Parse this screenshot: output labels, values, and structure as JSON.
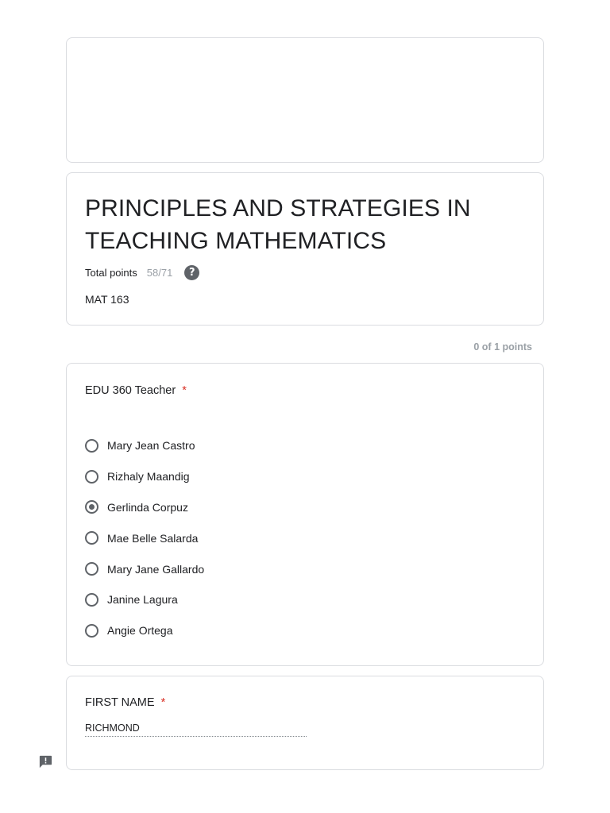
{
  "form": {
    "title": "PRINCIPLES AND STRATEGIES IN TEACHING MATHEMATICS",
    "total_points_label": "Total points",
    "total_points_value": "58/71",
    "course_code": "MAT 163"
  },
  "question_edu360": {
    "score": "0 of 1 points",
    "title": "EDU 360 Teacher",
    "required_mark": "*",
    "options": [
      {
        "label": "Mary Jean Castro",
        "selected": false
      },
      {
        "label": "Rizhaly Maandig",
        "selected": false
      },
      {
        "label": "Gerlinda Corpuz",
        "selected": true
      },
      {
        "label": "Mae Belle Salarda",
        "selected": false
      },
      {
        "label": "Mary Jane Gallardo",
        "selected": false
      },
      {
        "label": "Janine Lagura",
        "selected": false
      },
      {
        "label": "Angie Ortega",
        "selected": false
      }
    ]
  },
  "question_first_name": {
    "title": "FIRST NAME",
    "required_mark": "*",
    "answer": "RICHMOND"
  },
  "icons": {
    "help": "help-circle-icon",
    "feedback": "feedback-icon"
  },
  "colors": {
    "required": "#d93025",
    "muted": "#9aa0a6",
    "border": "#dadce0"
  }
}
